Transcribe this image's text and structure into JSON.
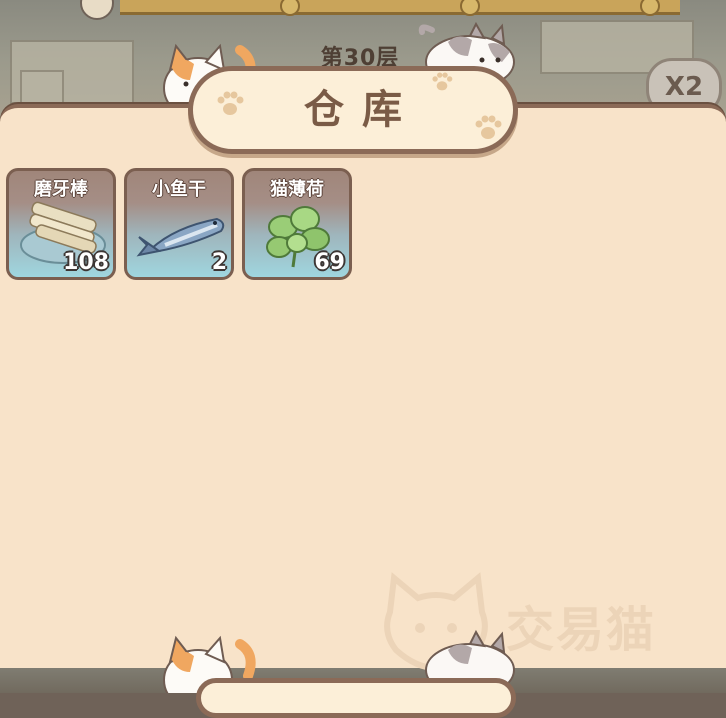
{
  "hud": {
    "floor": "第30层",
    "multiplier": "X2"
  },
  "panel": {
    "title": "仓库"
  },
  "items": [
    {
      "name": "磨牙棒",
      "count": "108",
      "icon": "chew-stick-icon"
    },
    {
      "name": "小鱼干",
      "count": "2",
      "icon": "dried-fish-icon"
    },
    {
      "name": "猫薄荷",
      "count": "69",
      "icon": "catnip-icon"
    }
  ],
  "watermark": {
    "text": "交易猫",
    "icon": "cat-face-watermark-icon"
  },
  "colors": {
    "panel_bg": "#f8e3c9",
    "panel_border": "#8b6a57",
    "title_text": "#7a5b46",
    "card_top": "#a0867a",
    "card_bottom": "#9fd6df"
  }
}
